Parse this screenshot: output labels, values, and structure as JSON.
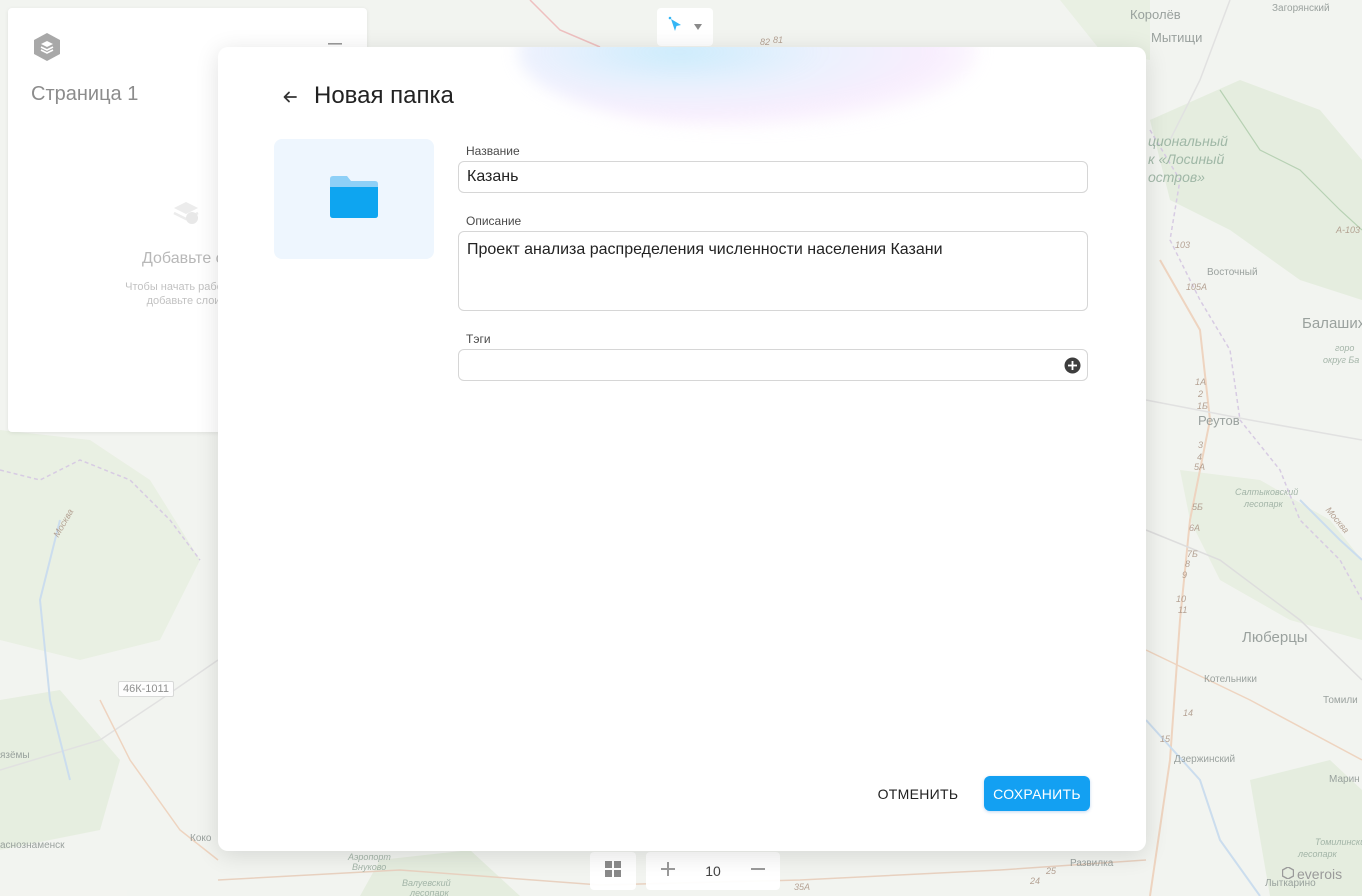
{
  "map": {
    "labels": [
      "Королёв",
      "Загорянский",
      "Мытищи",
      "циональный",
      "к «Лосиный",
      "остров»",
      "Восточный",
      "Балаших",
      "горо",
      "округ Ба",
      "Реутов",
      "Салтыковский",
      "лесопарк",
      "Люберцы",
      "Котельники",
      "Томили",
      "Дзержинский",
      "Марин",
      "Томилинский",
      "лесопарк",
      "Лыткарино",
      "Развилка",
      "Москва",
      "Москва",
      "язёмы",
      "аснознаменск",
      "Коко",
      "Аэропорт",
      "Внуково",
      "Валуевский",
      "лесопарк",
      "Добавьте сл",
      "Чтобы начать работу с п",
      "добавьте слои в"
    ],
    "road_numbers": [
      "82",
      "81",
      "103",
      "105А",
      "1А",
      "2",
      "1Б",
      "3",
      "4",
      "5А",
      "5Б",
      "6А",
      "7Б",
      "8",
      "9",
      "10",
      "11",
      "14",
      "15",
      "24",
      "25",
      "35А",
      "А-103"
    ],
    "road_badge": "46К-1011"
  },
  "left_panel": {
    "page_title": "Страница 1",
    "empty_title": "Добавьте сл",
    "empty_text_1": "Чтобы начать работу с п",
    "empty_text_2": "добавьте слои в",
    "logo_icon": "layers-logo-icon",
    "menu_icon": "hamburger-menu-icon"
  },
  "top_tool": {
    "icon": "cursor-select-icon",
    "dropdown_icon": "caret-down-icon"
  },
  "bottom": {
    "grid_icon": "grid-icon",
    "zoom_in_icon": "plus-icon",
    "zoom_level": "10",
    "zoom_out_icon": "minus-icon"
  },
  "watermark": "everois",
  "dialog": {
    "title": "Новая папка",
    "back_icon": "arrow-left-icon",
    "folder_icon": "folder-icon",
    "name_label": "Название",
    "name_value": "Казань",
    "description_label": "Описание",
    "description_value": "Проект анализа распределения численности населения Казани",
    "tags_label": "Тэги",
    "tags_value": "",
    "tags_add_icon": "add-circle-icon",
    "cancel_label": "ОТМЕНИТЬ",
    "save_label": "СОХРАНИТЬ",
    "accent_color": "#13a0f2",
    "folder_color": "#0ea5f0"
  }
}
